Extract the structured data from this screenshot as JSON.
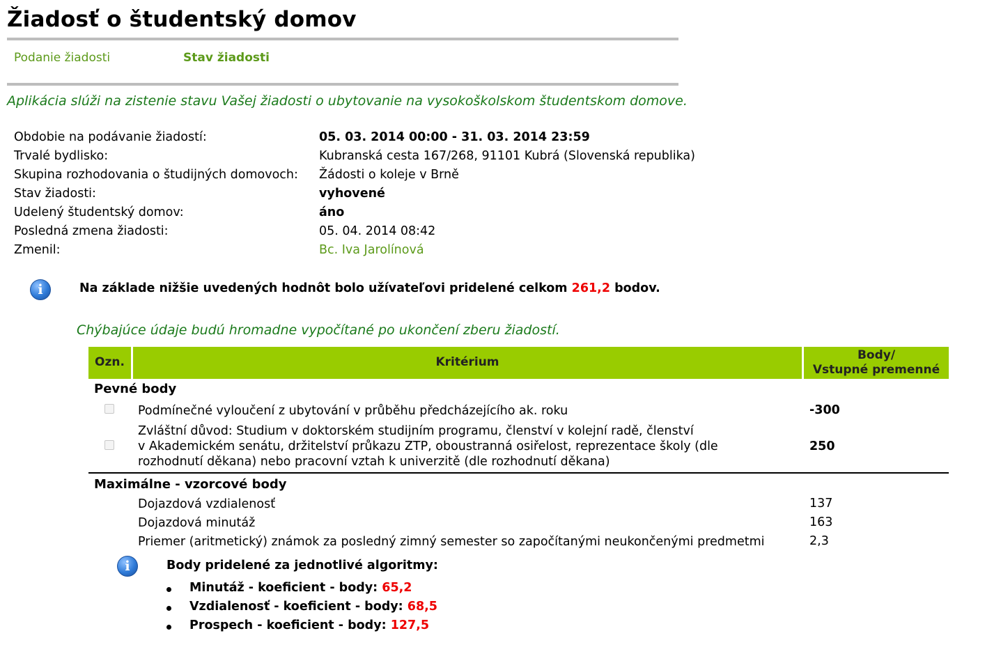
{
  "page_title": "Žiadosť o študentský domov",
  "nav": {
    "submit": "Podanie žiadosti",
    "status": "Stav žiadosti"
  },
  "intro": "Aplikácia slúži na zistenie stavu Vašej žiadosti o ubytovanie na vysokoškolskom študentskom domove.",
  "info": [
    {
      "label": "Obdobie na podávanie žiadostí:",
      "value": "05. 03. 2014 00:00 - 31. 03. 2014 23:59"
    },
    {
      "label": "Trvalé bydlisko:",
      "value": "Kubranská cesta 167/268, 91101 Kubrá (Slovenská republika)"
    },
    {
      "label": "Skupina rozhodovania o študijných domovoch:",
      "value": "Žádosti o koleje v Brně"
    },
    {
      "label": "Stav žiadosti:",
      "value": "vyhovené"
    },
    {
      "label": "Udelený študentský domov:",
      "value": "áno"
    },
    {
      "label": "Posledná zmena žiadosti:",
      "value": "05. 04. 2014 08:42"
    },
    {
      "label": "Zmenil:",
      "value": "Bc. Iva Jarolínová"
    }
  ],
  "summary": {
    "prefix": "Na základe nižšie uvedených hodnôt bolo užívateľovi pridelené celkom",
    "points": "261,2",
    "suffix": "bodov."
  },
  "missing_note": "Chýbajúce údaje budú hromadne vypočítané po ukončení zberu žiadostí.",
  "table": {
    "col_ozn": "Ozn.",
    "col_krit": "Kritérium",
    "col_body_1": "Body/",
    "col_body_2": "Vstupné premenné",
    "section_fixed": "Pevné body",
    "fixed_rows": [
      {
        "lines": [
          "Podmínečné vyloučení z ubytování v průběhu předcházejícího ak. roku"
        ],
        "value": "-300"
      },
      {
        "lines": [
          "Zvláštní důvod: Studium v doktorském studijním programu, členství v kolejní radě, členství",
          "v Akademickém senátu, držitelství průkazu ZTP, oboustranná osiřelost, reprezentace školy (dle",
          "rozhodnutí děkana) nebo pracovní vztah k univerzitě (dle rozhodnutí děkana)"
        ],
        "value": "250"
      }
    ],
    "section_formula": "Maximálne - vzorcové body",
    "formula_rows": [
      {
        "label": "Dojazdová vzdialenosť",
        "value": "137"
      },
      {
        "label": "Dojazdová minutáž",
        "value": "163"
      },
      {
        "label": "Priemer (aritmetický) známok za posledný zimný semester so započítanými neukončenými predmetmi",
        "value": "2,3"
      }
    ]
  },
  "algorithms": {
    "heading": "Body pridelené za jednotlivé algoritmy:",
    "items": [
      {
        "label": "Minutáž - koeficient - body:",
        "value": "65,2"
      },
      {
        "label": "Vzdialenosť - koeficient - body:",
        "value": "68,5"
      },
      {
        "label": "Prospech - koeficient - body:",
        "value": "127,5"
      }
    ]
  },
  "colors": {
    "link_green": "#5c9a1a",
    "italic_green": "#1b7a1b",
    "header_green": "#99cc00",
    "points_red": "#ee0000"
  },
  "icons": {
    "info": "info-icon"
  }
}
